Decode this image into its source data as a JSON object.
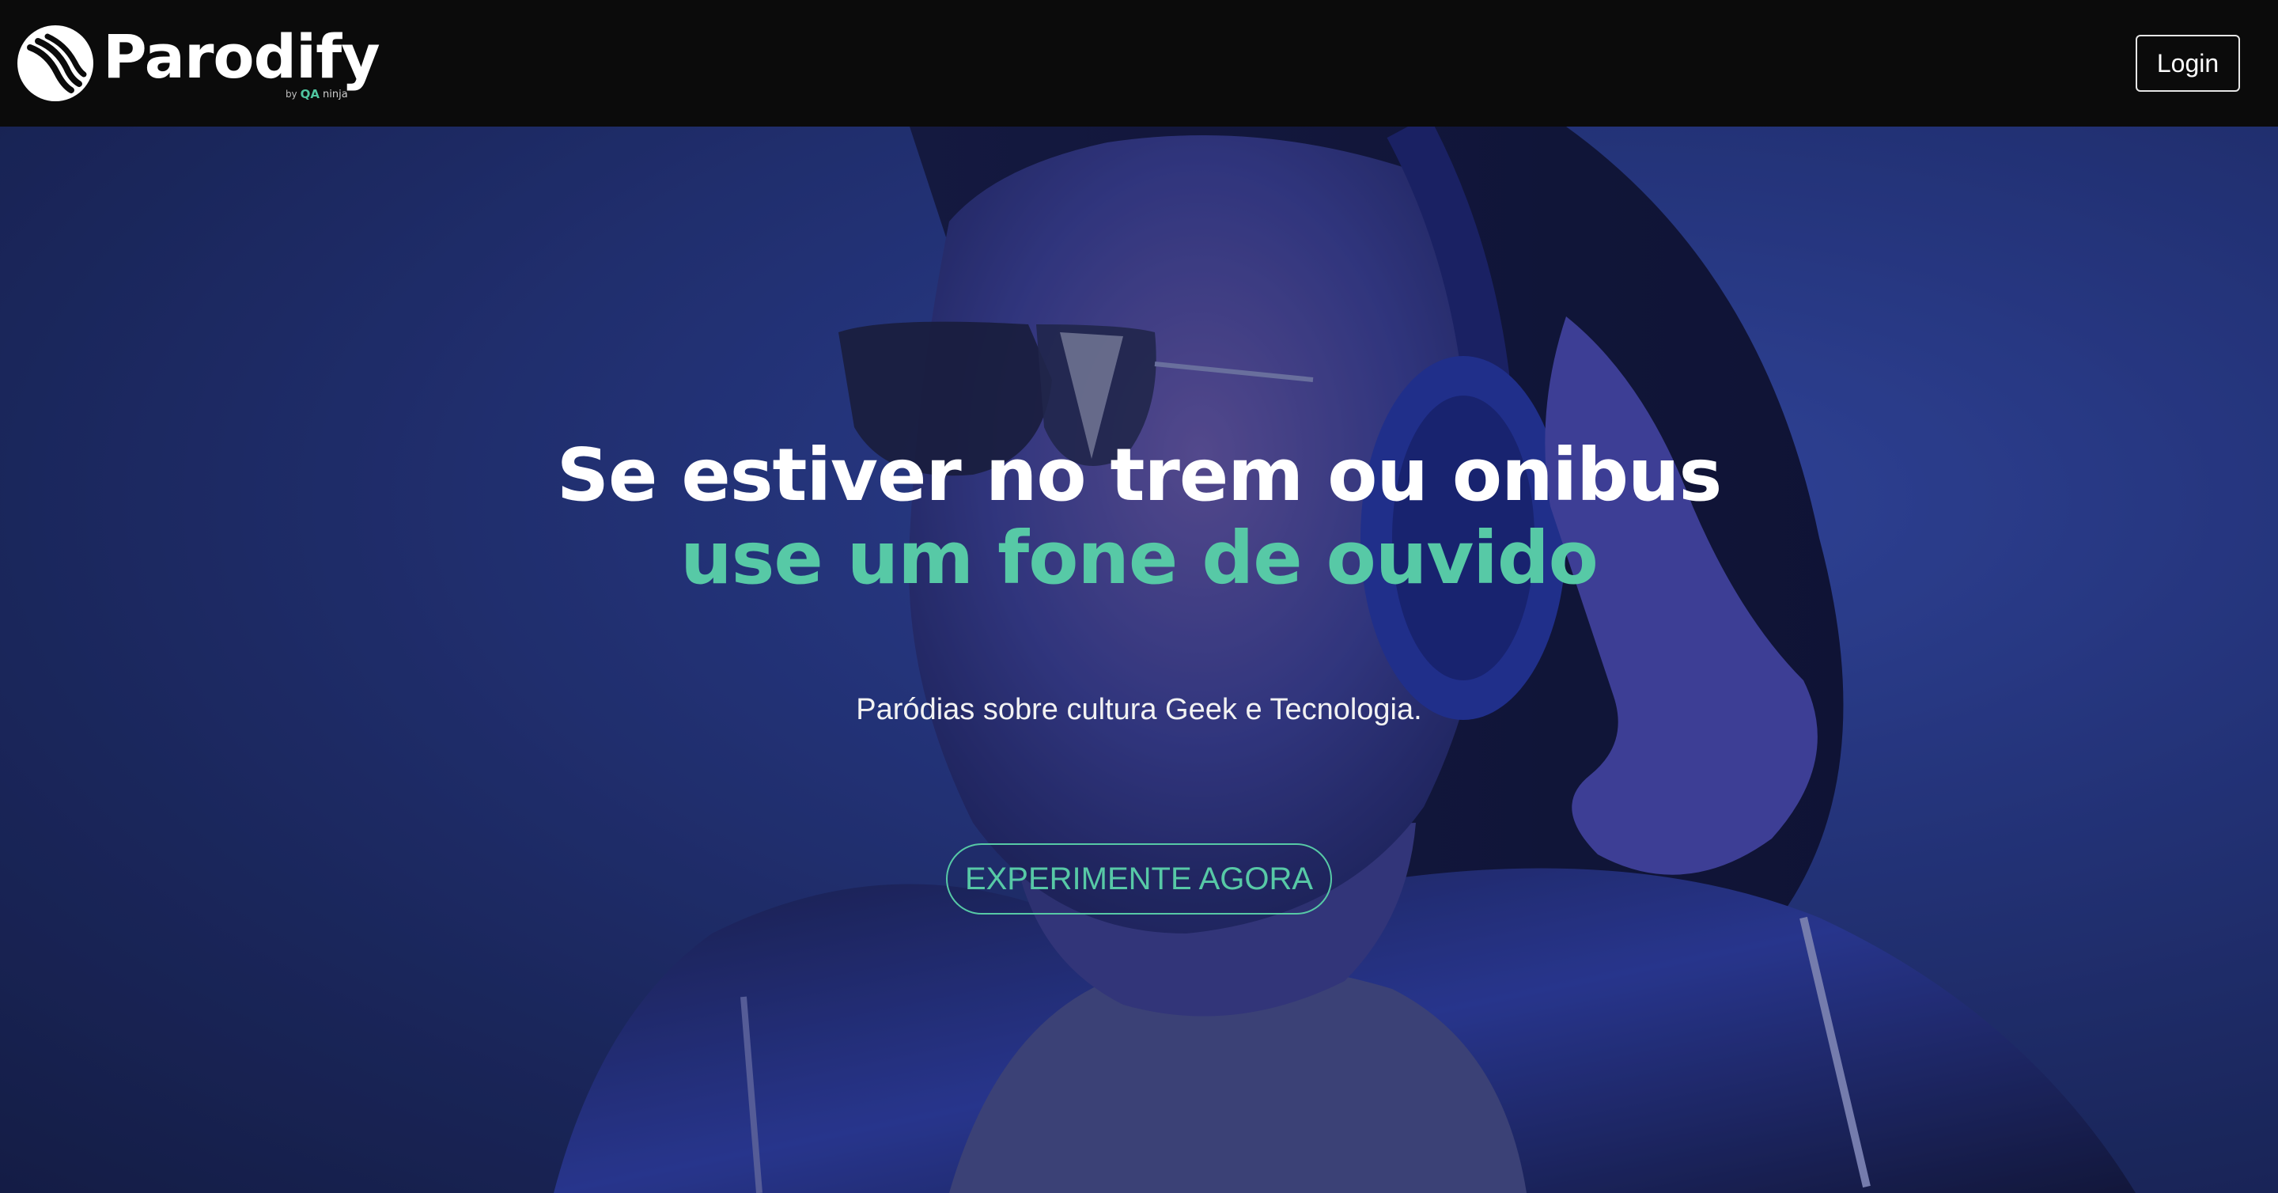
{
  "navbar": {
    "brand_name": "Parodify",
    "brand_by": "by",
    "brand_qa": "QA",
    "brand_ninja": "ninja",
    "login_label": "Login"
  },
  "hero": {
    "headline_line1": "Se estiver no trem ou onibus",
    "headline_line2": "use um fone de ouvido",
    "tagline": "Paródias sobre cultura Geek e Tecnologia.",
    "cta_label": "EXPERIMENTE AGORA",
    "image": "woman-with-headphones-photo"
  },
  "colors": {
    "navbar_bg": "#0b0b0b",
    "accent": "#57c9a6",
    "hero_blue": "#2a3d8f",
    "text": "#ffffff"
  }
}
